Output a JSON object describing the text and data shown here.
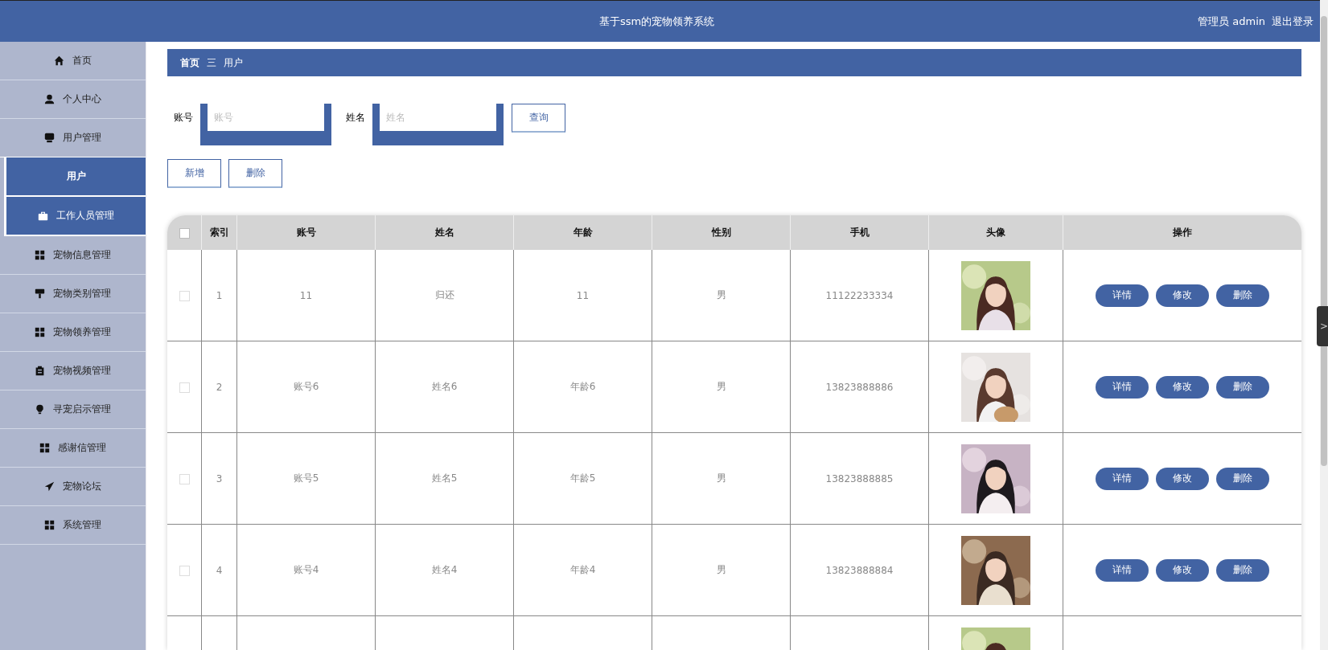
{
  "header": {
    "title": "基于ssm的宠物领养系统",
    "user": "管理员 admin",
    "logout": "退出登录"
  },
  "sidebar": {
    "items": [
      {
        "label": "首页",
        "selected": false,
        "hovered": false
      },
      {
        "label": "个人中心",
        "selected": false,
        "hovered": false
      },
      {
        "label": "用户管理",
        "selected": false,
        "hovered": false,
        "expanded": true,
        "children": [
          {
            "label": "用户",
            "selected": true
          }
        ]
      },
      {
        "label": "工作人员管理",
        "selected": false,
        "hovered": true
      },
      {
        "label": "宠物信息管理",
        "selected": false,
        "hovered": false
      },
      {
        "label": "宠物类别管理",
        "selected": false,
        "hovered": false
      },
      {
        "label": "宠物领养管理",
        "selected": false,
        "hovered": false
      },
      {
        "label": "宠物视频管理",
        "selected": false,
        "hovered": false
      },
      {
        "label": "寻宠启示管理",
        "selected": false,
        "hovered": false
      },
      {
        "label": "感谢信管理",
        "selected": false,
        "hovered": false
      },
      {
        "label": "宠物论坛",
        "selected": false,
        "hovered": false
      },
      {
        "label": "系统管理",
        "selected": false,
        "hovered": false
      }
    ]
  },
  "breadcrumb": {
    "home": "首页",
    "separator": "三",
    "current": "用户"
  },
  "search": {
    "fields": [
      {
        "label": "账号",
        "placeholder": "账号"
      },
      {
        "label": "姓名",
        "placeholder": "姓名"
      }
    ],
    "button": "查询"
  },
  "actions": [
    "新增",
    "删除"
  ],
  "table": {
    "select_all": false,
    "columns": [
      "索引",
      "账号",
      "姓名",
      "年龄",
      "性别",
      "手机",
      "头像",
      "操作"
    ],
    "rows": [
      {
        "checked": false,
        "cells": [
          "1",
          "11",
          "归还",
          "11",
          "男",
          "11122233334"
        ],
        "avatar": {
          "kind": "picture"
        },
        "buttons": [
          "详情",
          "修改",
          "删除"
        ]
      },
      {
        "checked": false,
        "cells": [
          "2",
          "账号6",
          "姓名6",
          "年龄6",
          "男",
          "13823888886"
        ],
        "avatar": {
          "kind": "picture"
        },
        "buttons": [
          "详情",
          "修改",
          "删除"
        ]
      },
      {
        "checked": false,
        "cells": [
          "3",
          "账号5",
          "姓名5",
          "年龄5",
          "男",
          "13823888885"
        ],
        "avatar": {
          "kind": "picture"
        },
        "buttons": [
          "详情",
          "修改",
          "删除"
        ]
      },
      {
        "checked": false,
        "cells": [
          "4",
          "账号4",
          "姓名4",
          "年龄4",
          "男",
          "13823888884"
        ],
        "avatar": {
          "kind": "picture"
        },
        "buttons": [
          "详情",
          "修改",
          "删除"
        ]
      },
      {
        "avatar": {
          "kind": "picture"
        }
      }
    ]
  },
  "side_tab": {
    "label": ">"
  }
}
